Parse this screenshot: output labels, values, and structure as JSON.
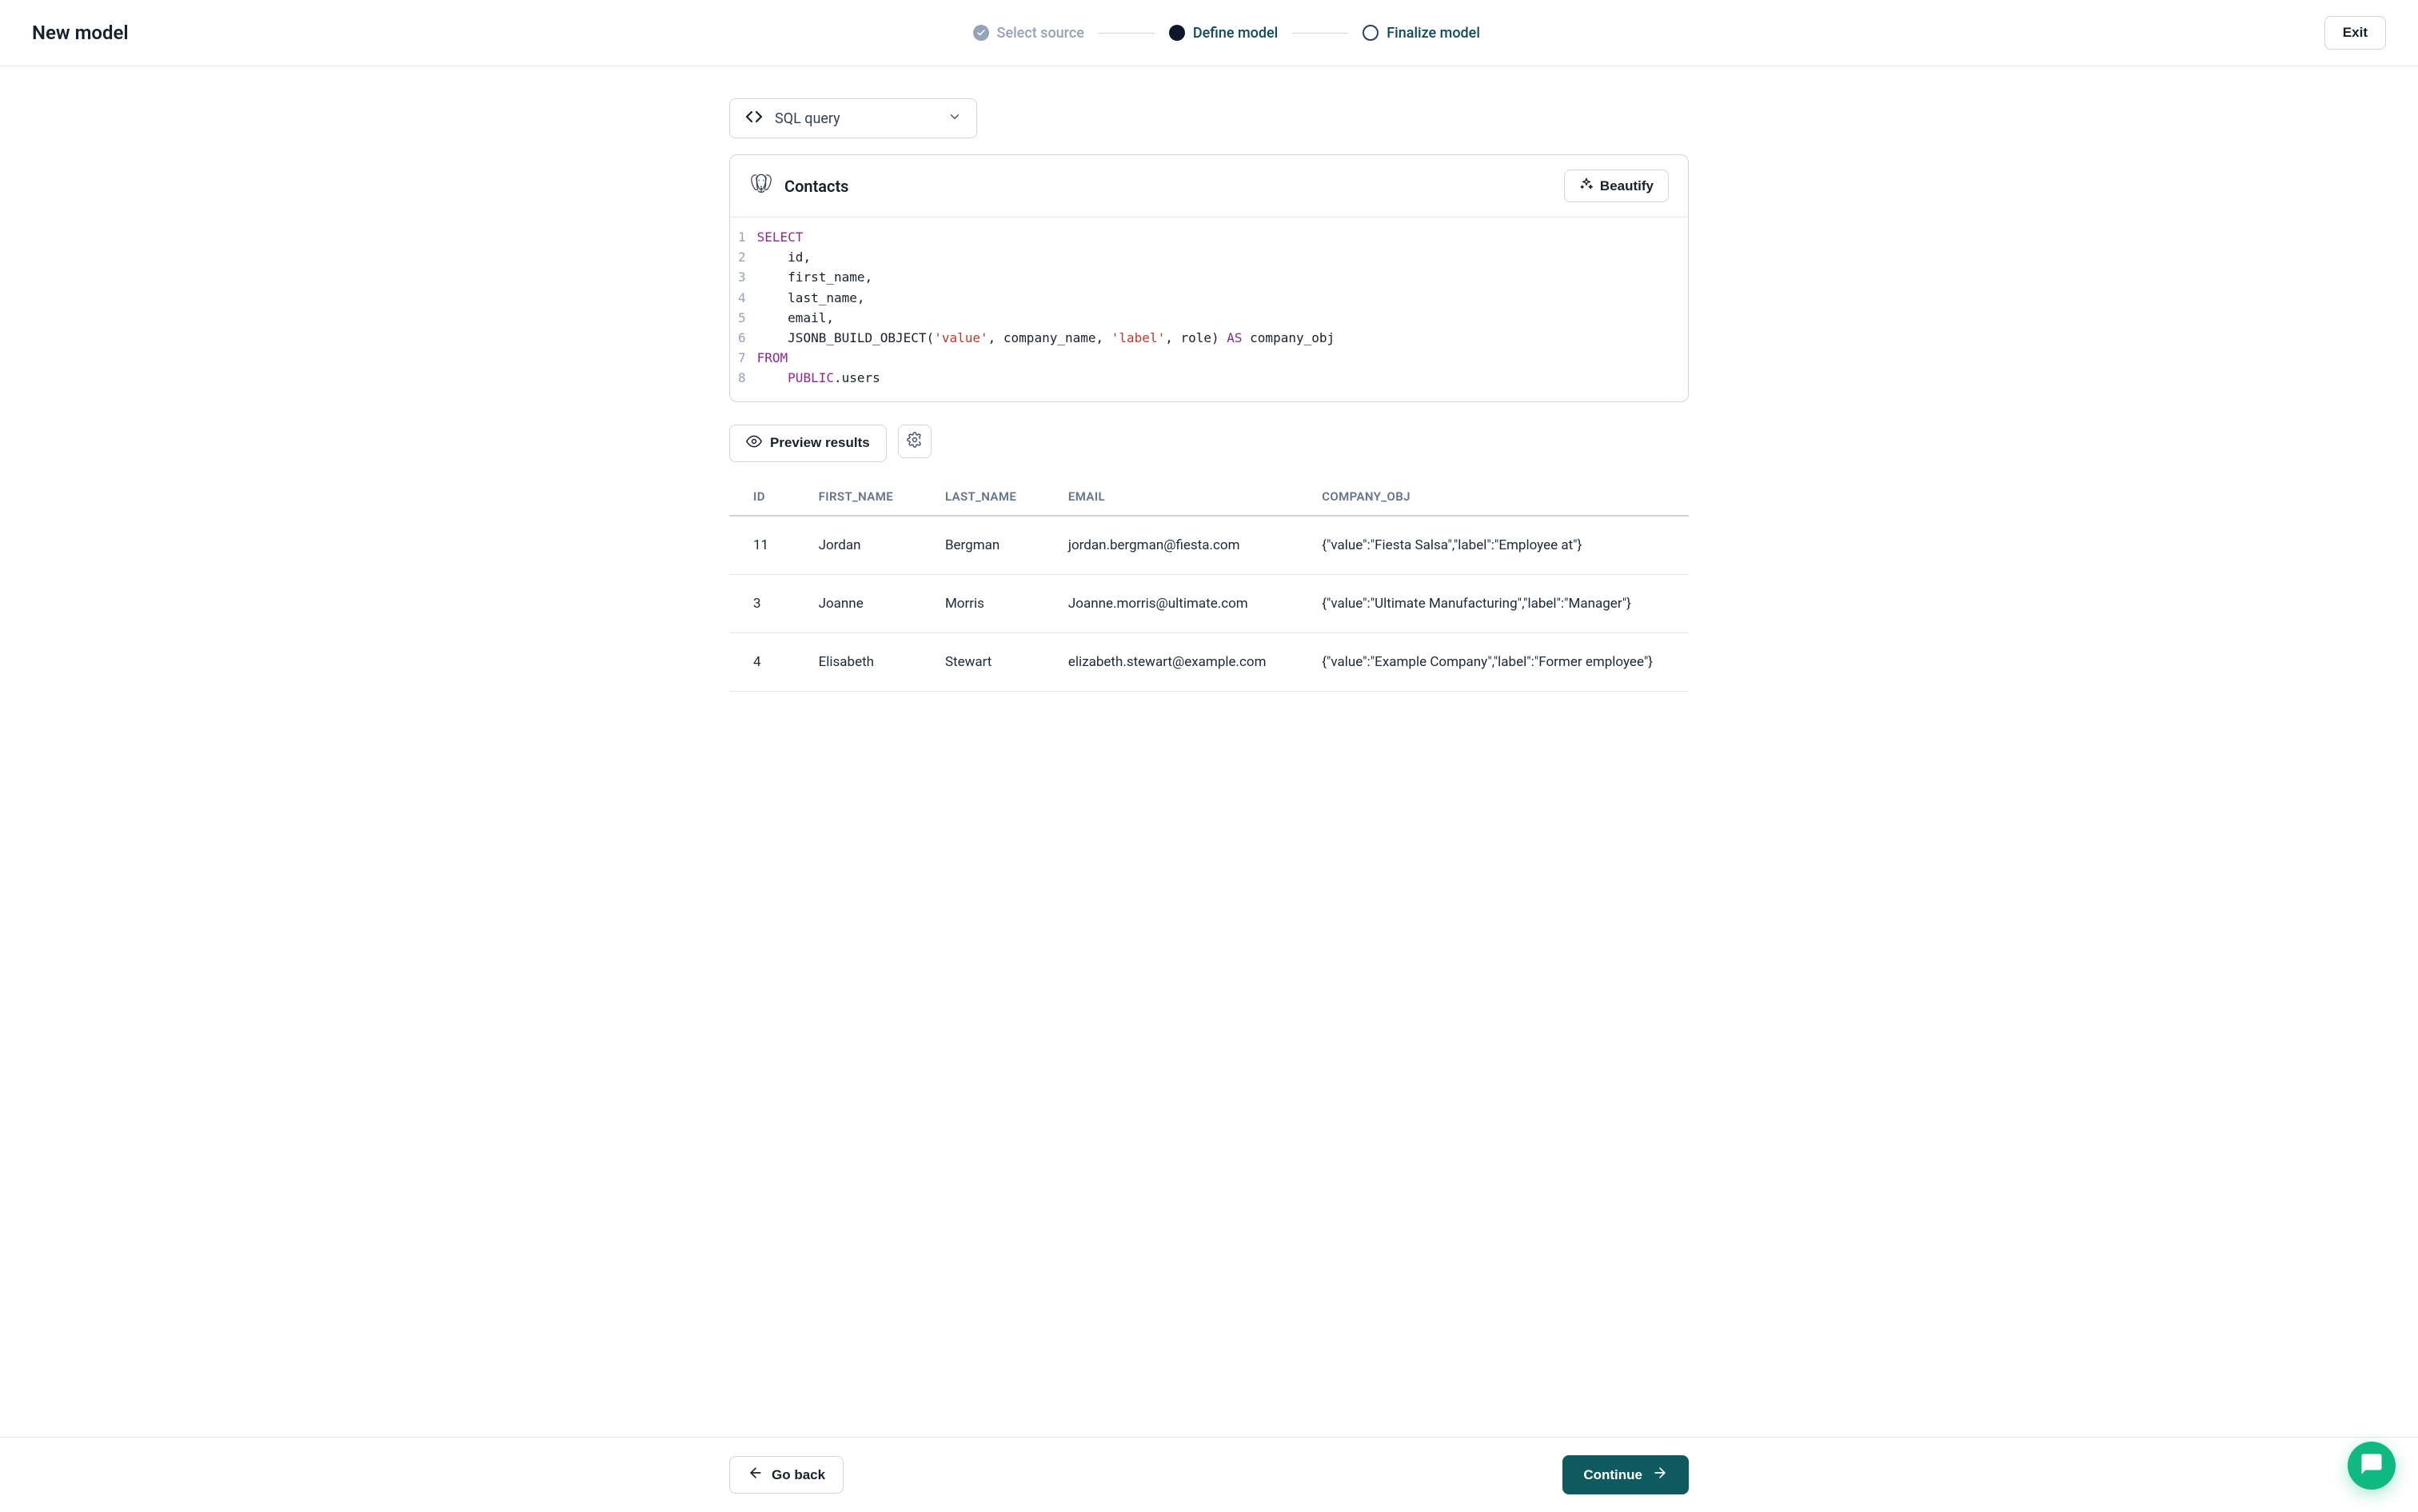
{
  "header": {
    "title": "New model",
    "steps": [
      {
        "label": "Select source",
        "state": "done"
      },
      {
        "label": "Define model",
        "state": "active"
      },
      {
        "label": "Finalize model",
        "state": "pending"
      }
    ],
    "exit_label": "Exit"
  },
  "source_selector": {
    "label": "SQL query"
  },
  "editor": {
    "database_type": "postgres",
    "title": "Contacts",
    "beautify_label": "Beautify",
    "code_lines": [
      {
        "n": 1,
        "tokens": [
          {
            "t": "SELECT",
            "c": "kw"
          }
        ]
      },
      {
        "n": 2,
        "tokens": [
          {
            "t": "    id,",
            "c": ""
          }
        ]
      },
      {
        "n": 3,
        "tokens": [
          {
            "t": "    first_name,",
            "c": ""
          }
        ]
      },
      {
        "n": 4,
        "tokens": [
          {
            "t": "    last_name,",
            "c": ""
          }
        ]
      },
      {
        "n": 5,
        "tokens": [
          {
            "t": "    email,",
            "c": ""
          }
        ]
      },
      {
        "n": 6,
        "tokens": [
          {
            "t": "    JSONB_BUILD_OBJECT(",
            "c": ""
          },
          {
            "t": "'value'",
            "c": "str"
          },
          {
            "t": ", company_name, ",
            "c": ""
          },
          {
            "t": "'label'",
            "c": "str"
          },
          {
            "t": ", role) ",
            "c": ""
          },
          {
            "t": "AS",
            "c": "kw"
          },
          {
            "t": " company_obj",
            "c": ""
          }
        ]
      },
      {
        "n": 7,
        "tokens": [
          {
            "t": "FROM",
            "c": "kw"
          }
        ]
      },
      {
        "n": 8,
        "tokens": [
          {
            "t": "    ",
            "c": ""
          },
          {
            "t": "PUBLIC",
            "c": "kw"
          },
          {
            "t": ".users",
            "c": ""
          }
        ]
      }
    ]
  },
  "actions": {
    "preview_label": "Preview results"
  },
  "results": {
    "columns": [
      "ID",
      "FIRST_NAME",
      "LAST_NAME",
      "EMAIL",
      "COMPANY_OBJ"
    ],
    "rows": [
      {
        "id": "11",
        "first_name": "Jordan",
        "last_name": "Bergman",
        "email": "jordan.bergman@fiesta.com",
        "company_obj": "{\"value\":\"Fiesta Salsa\",\"label\":\"Employee at\"}"
      },
      {
        "id": "3",
        "first_name": "Joanne",
        "last_name": "Morris",
        "email": "Joanne.morris@ultimate.com",
        "company_obj": "{\"value\":\"Ultimate Manufacturing\",\"label\":\"Manager\"}"
      },
      {
        "id": "4",
        "first_name": "Elisabeth",
        "last_name": "Stewart",
        "email": "elizabeth.stewart@example.com",
        "company_obj": "{\"value\":\"Example Company\",\"label\":\"Former employee\"}"
      }
    ]
  },
  "footer": {
    "goback_label": "Go back",
    "continue_label": "Continue"
  }
}
